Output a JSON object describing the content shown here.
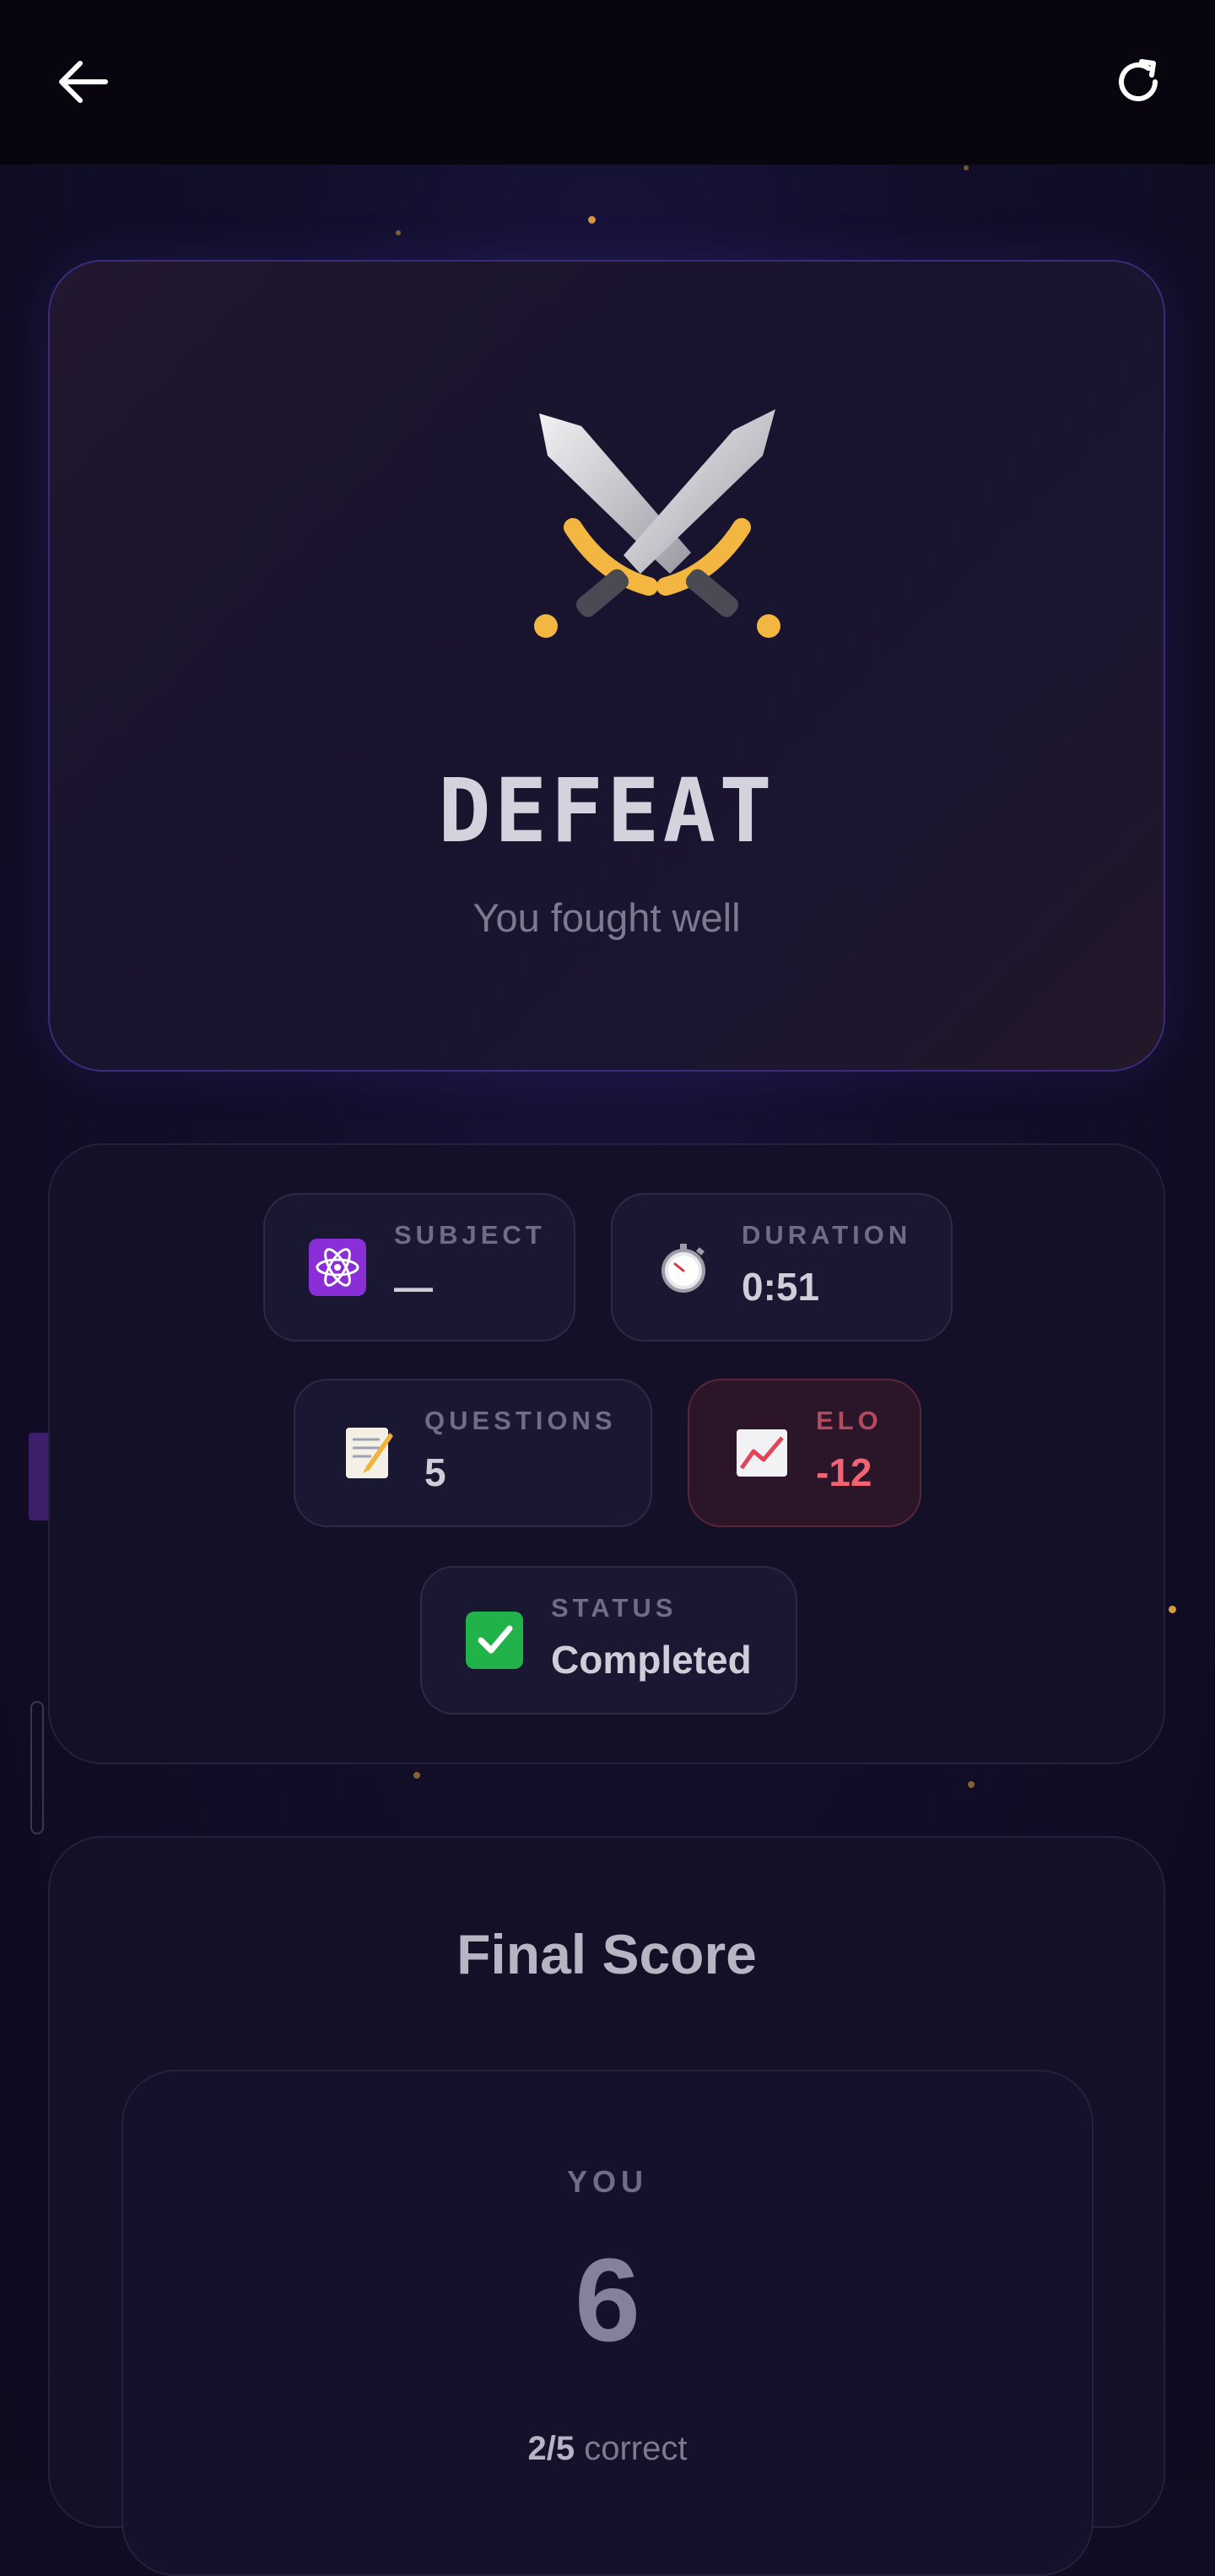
{
  "header": {
    "back_icon": "arrow-left-icon",
    "refresh_icon": "refresh-icon"
  },
  "hero": {
    "icon": "crossed-swords-icon",
    "title": "DEFEAT",
    "subtitle": "You fought well"
  },
  "stats": {
    "subject": {
      "icon": "atom-icon",
      "label": "SUBJECT",
      "value": "—"
    },
    "duration": {
      "icon": "stopwatch-icon",
      "label": "DURATION",
      "value": "0:51"
    },
    "questions": {
      "icon": "memo-icon",
      "label": "QUESTIONS",
      "value": "5"
    },
    "elo": {
      "icon": "chart-increasing-icon",
      "label": "ELO",
      "value": "-12"
    },
    "status": {
      "icon": "check-mark-icon",
      "label": "STATUS",
      "value": "Completed"
    }
  },
  "final_score": {
    "title": "Final Score",
    "player_label": "YOU",
    "score": "6",
    "correct_count": "2/5",
    "correct_suffix": "correct"
  },
  "colors": {
    "elo_negative": "#f06473",
    "hero_border": "#3a2c7c",
    "background": "#100d22"
  }
}
